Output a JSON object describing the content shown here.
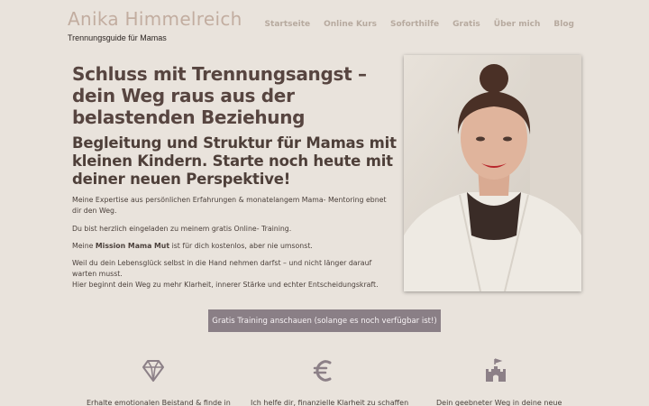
{
  "header": {
    "site_title": "Anika Himmelreich",
    "tagline": "Trennungsguide für Mamas",
    "nav": [
      "Startseite",
      "Online Kurs",
      "Soforthilfe",
      "Gratis",
      "Über mich",
      "Blog"
    ]
  },
  "hero": {
    "title": "Schluss mit Trennungsangst – dein Weg raus aus der belastenden Beziehung",
    "subtitle": "Begleitung und Struktur für Mamas mit kleinen Kindern. Starte noch heute mit deiner neuen Perspektive!",
    "p1": "Meine Expertise aus persönlichen Erfahrungen & monatelangem Mama- Mentoring ebnet dir den Weg.",
    "p2": "Du bist herzlich eingeladen zu meinem gratis Online- Training.",
    "p3_before": "Meine ",
    "p3_bold": "Mission Mama Mut",
    "p3_after": " ist für dich kostenlos, aber nie umsonst.",
    "p4_line1": "Weil du dein Lebensglück selbst in die Hand nehmen darfst – und nicht länger darauf warten musst.",
    "p4_line2": "Hier beginnt dein Weg zu mehr Klarheit, innerer Stärke und echter Entscheidungskraft.",
    "cta_label": "Gratis Training anschauen (solange es noch verfügbar ist!)"
  },
  "features": [
    {
      "icon": "diamond-icon",
      "text": "Erhalte emotionalen Beistand & finde in"
    },
    {
      "icon": "euro-icon",
      "text": "Ich helfe dir, finanzielle Klarheit zu schaffen"
    },
    {
      "icon": "castle-icon",
      "text": "Dein geebneter Weg in deine neue"
    }
  ],
  "colors": {
    "background": "#e9e3dc",
    "cta": "#8a7f86",
    "icon": "#8c8087",
    "nav": "#b7aa9f"
  }
}
